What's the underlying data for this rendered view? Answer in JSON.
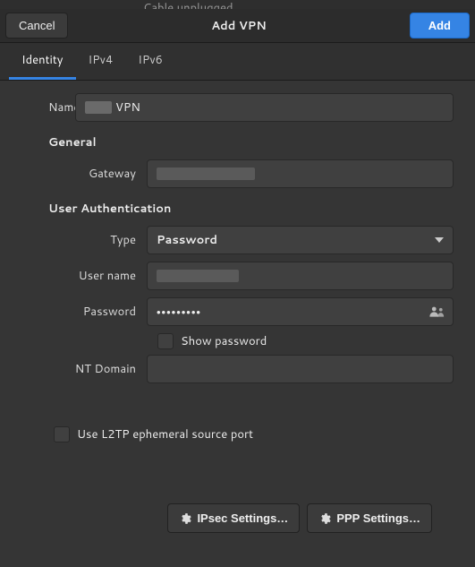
{
  "background": {
    "hint": "Cable unplugged"
  },
  "header": {
    "cancel": "Cancel",
    "title": "Add VPN",
    "add": "Add"
  },
  "tabs": {
    "identity": "Identity",
    "ipv4": "IPv4",
    "ipv6": "IPv6"
  },
  "identity": {
    "name_label": "Name",
    "name_suffix": "VPN",
    "general_title": "General",
    "gateway_label": "Gateway",
    "gateway_value": "",
    "userauth_title": "User Authentication",
    "type_label": "Type",
    "type_value": "Password",
    "username_label": "User name",
    "username_value": "",
    "password_label": "Password",
    "password_value": "•••••••••",
    "show_password_label": "Show password",
    "ntdomain_label": "NT Domain",
    "ntdomain_value": "",
    "l2tp_label": "Use L2TP ephemeral source port",
    "ipsec_button": "IPsec Settings…",
    "ppp_button": "PPP Settings…"
  }
}
